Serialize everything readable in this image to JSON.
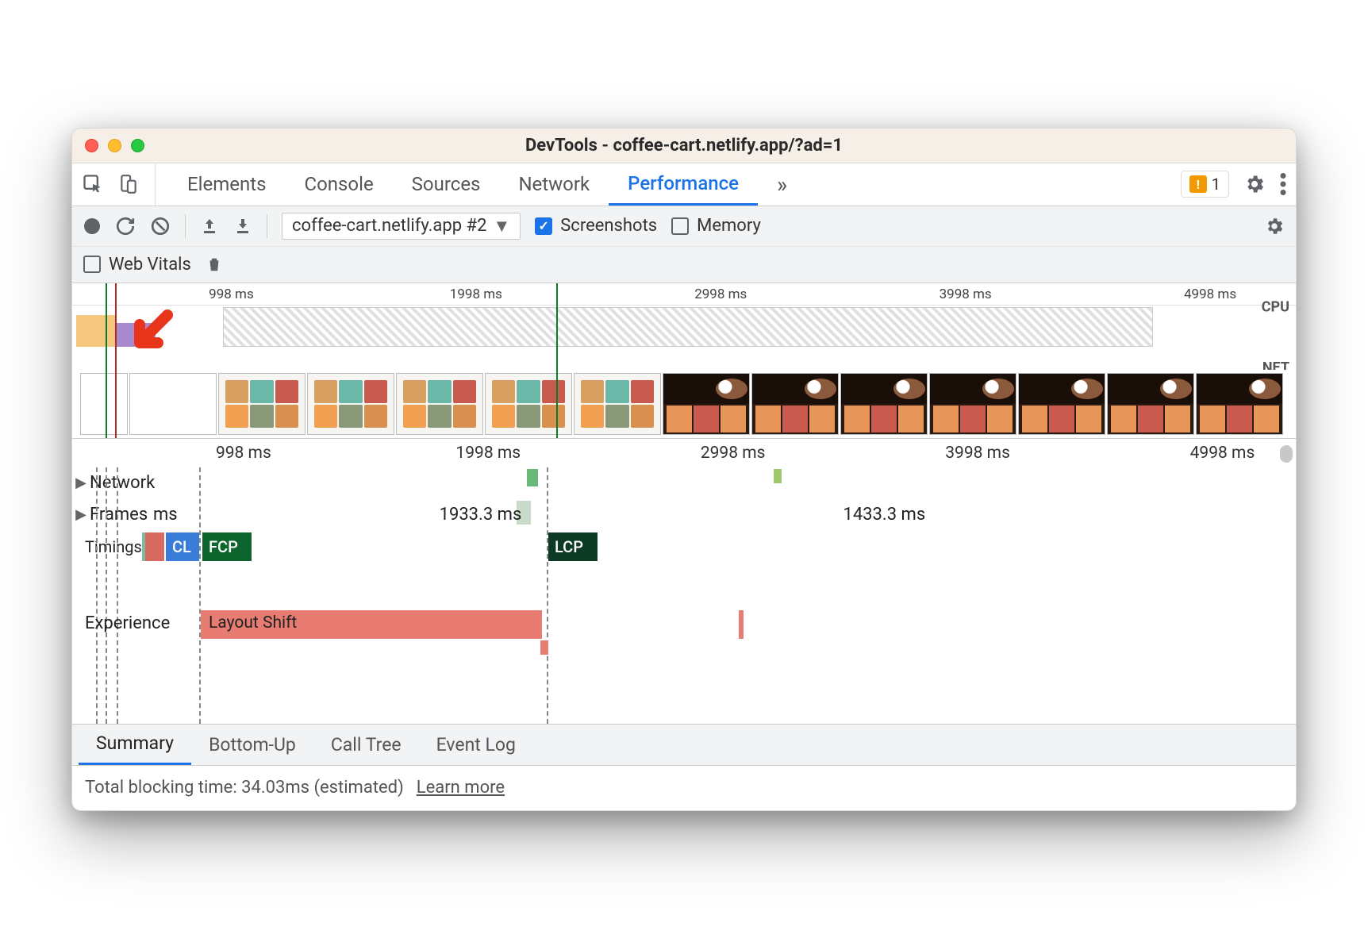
{
  "window": {
    "title": "DevTools - coffee-cart.netlify.app/?ad=1"
  },
  "devtools_tabs": {
    "items": [
      "Elements",
      "Console",
      "Sources",
      "Network",
      "Performance"
    ],
    "overflow": "»",
    "active_index": 4,
    "issues_count": "1"
  },
  "perf_toolbar": {
    "recording_name": "coffee-cart.netlify.app #2",
    "screenshots_label": "Screenshots",
    "screenshots_checked": true,
    "memory_label": "Memory",
    "memory_checked": false,
    "web_vitals_label": "Web Vitals",
    "web_vitals_checked": false
  },
  "overview": {
    "ruler_ticks": [
      "998 ms",
      "1998 ms",
      "2998 ms",
      "3998 ms",
      "4998 ms"
    ],
    "cpu_label": "CPU",
    "net_label": "NET"
  },
  "flame": {
    "ruler_ticks": [
      "998 ms",
      "1998 ms",
      "2998 ms",
      "3998 ms",
      "4998 ms"
    ],
    "tracks": {
      "network": "Network",
      "frames": "Frames",
      "timings": "Timings",
      "experience": "Experience"
    },
    "frames_values": [
      "ms",
      "1933.3 ms",
      "1433.3 ms"
    ],
    "timing_tags": {
      "cl": "CL",
      "fcp": "FCP",
      "lcp": "LCP"
    },
    "layout_shift_label": "Layout Shift"
  },
  "bottom_tabs": {
    "items": [
      "Summary",
      "Bottom-Up",
      "Call Tree",
      "Event Log"
    ],
    "active_index": 0
  },
  "summary": {
    "blocking_text": "Total blocking time: 34.03ms (estimated)",
    "learn_more": "Learn more"
  }
}
